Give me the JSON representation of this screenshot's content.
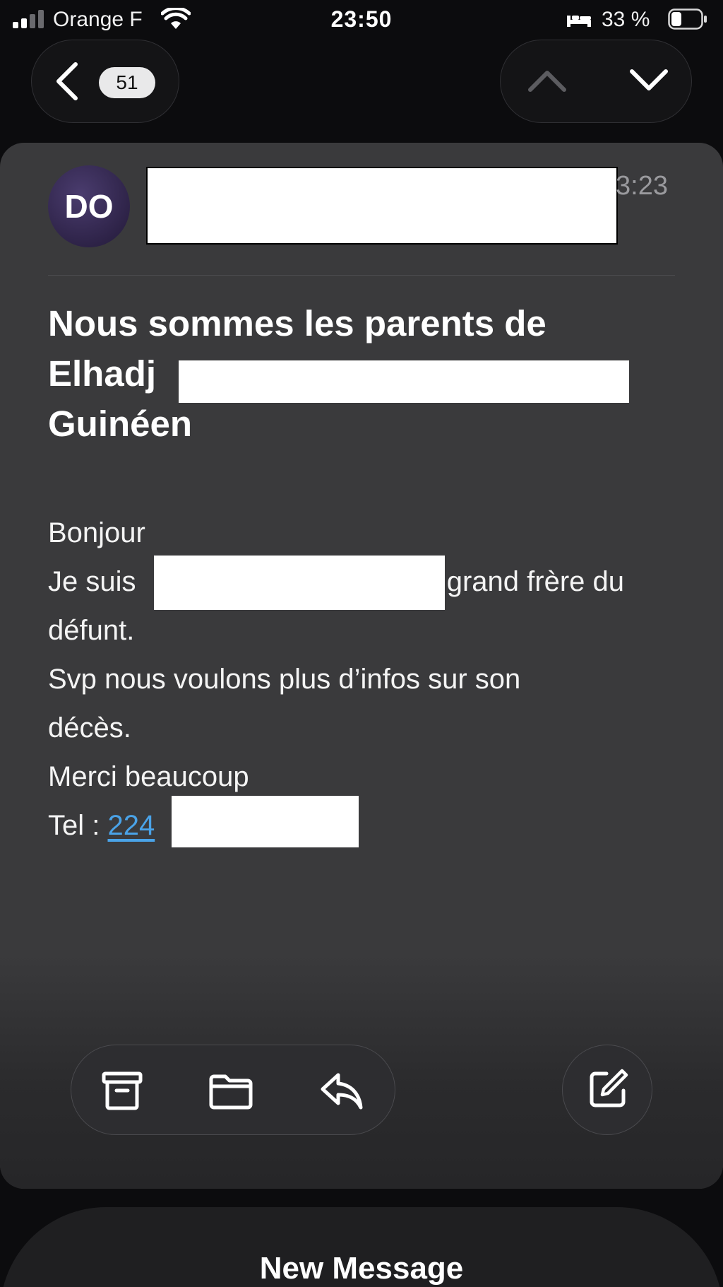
{
  "status_bar": {
    "carrier": "Orange F",
    "time": "23:50",
    "battery_percent": "33 %",
    "battery_level": 0.33
  },
  "nav": {
    "unread_count": "51"
  },
  "message": {
    "avatar_initials": "DO",
    "time": "3:23",
    "subject_line1": "Nous sommes les parents de",
    "subject_line2": "Elhadj",
    "subject_line3": "Guinéen",
    "body": {
      "greeting": "Bonjour",
      "intro_prefix": "Je suis",
      "intro_suffix": ", grand frère du",
      "intro_line2": "défunt.",
      "request_line1": "Svp nous voulons plus d’infos sur son",
      "request_line2": "décès.",
      "thanks": "Merci beaucoup",
      "tel_label": "Tel : ",
      "tel_link": "224"
    }
  },
  "sheet": {
    "title": "New Message"
  },
  "colors": {
    "background": "#0c0c0e",
    "card": "#3a3a3c",
    "link": "#4aa3e8",
    "badge": "#e9e9ea"
  },
  "icons": [
    "cellular-signal-icon",
    "wifi-icon",
    "sleep-bed-icon",
    "battery-icon",
    "back-chevron-icon",
    "up-chevron-icon",
    "down-chevron-icon",
    "archive-icon",
    "folder-icon",
    "reply-icon",
    "compose-icon"
  ]
}
